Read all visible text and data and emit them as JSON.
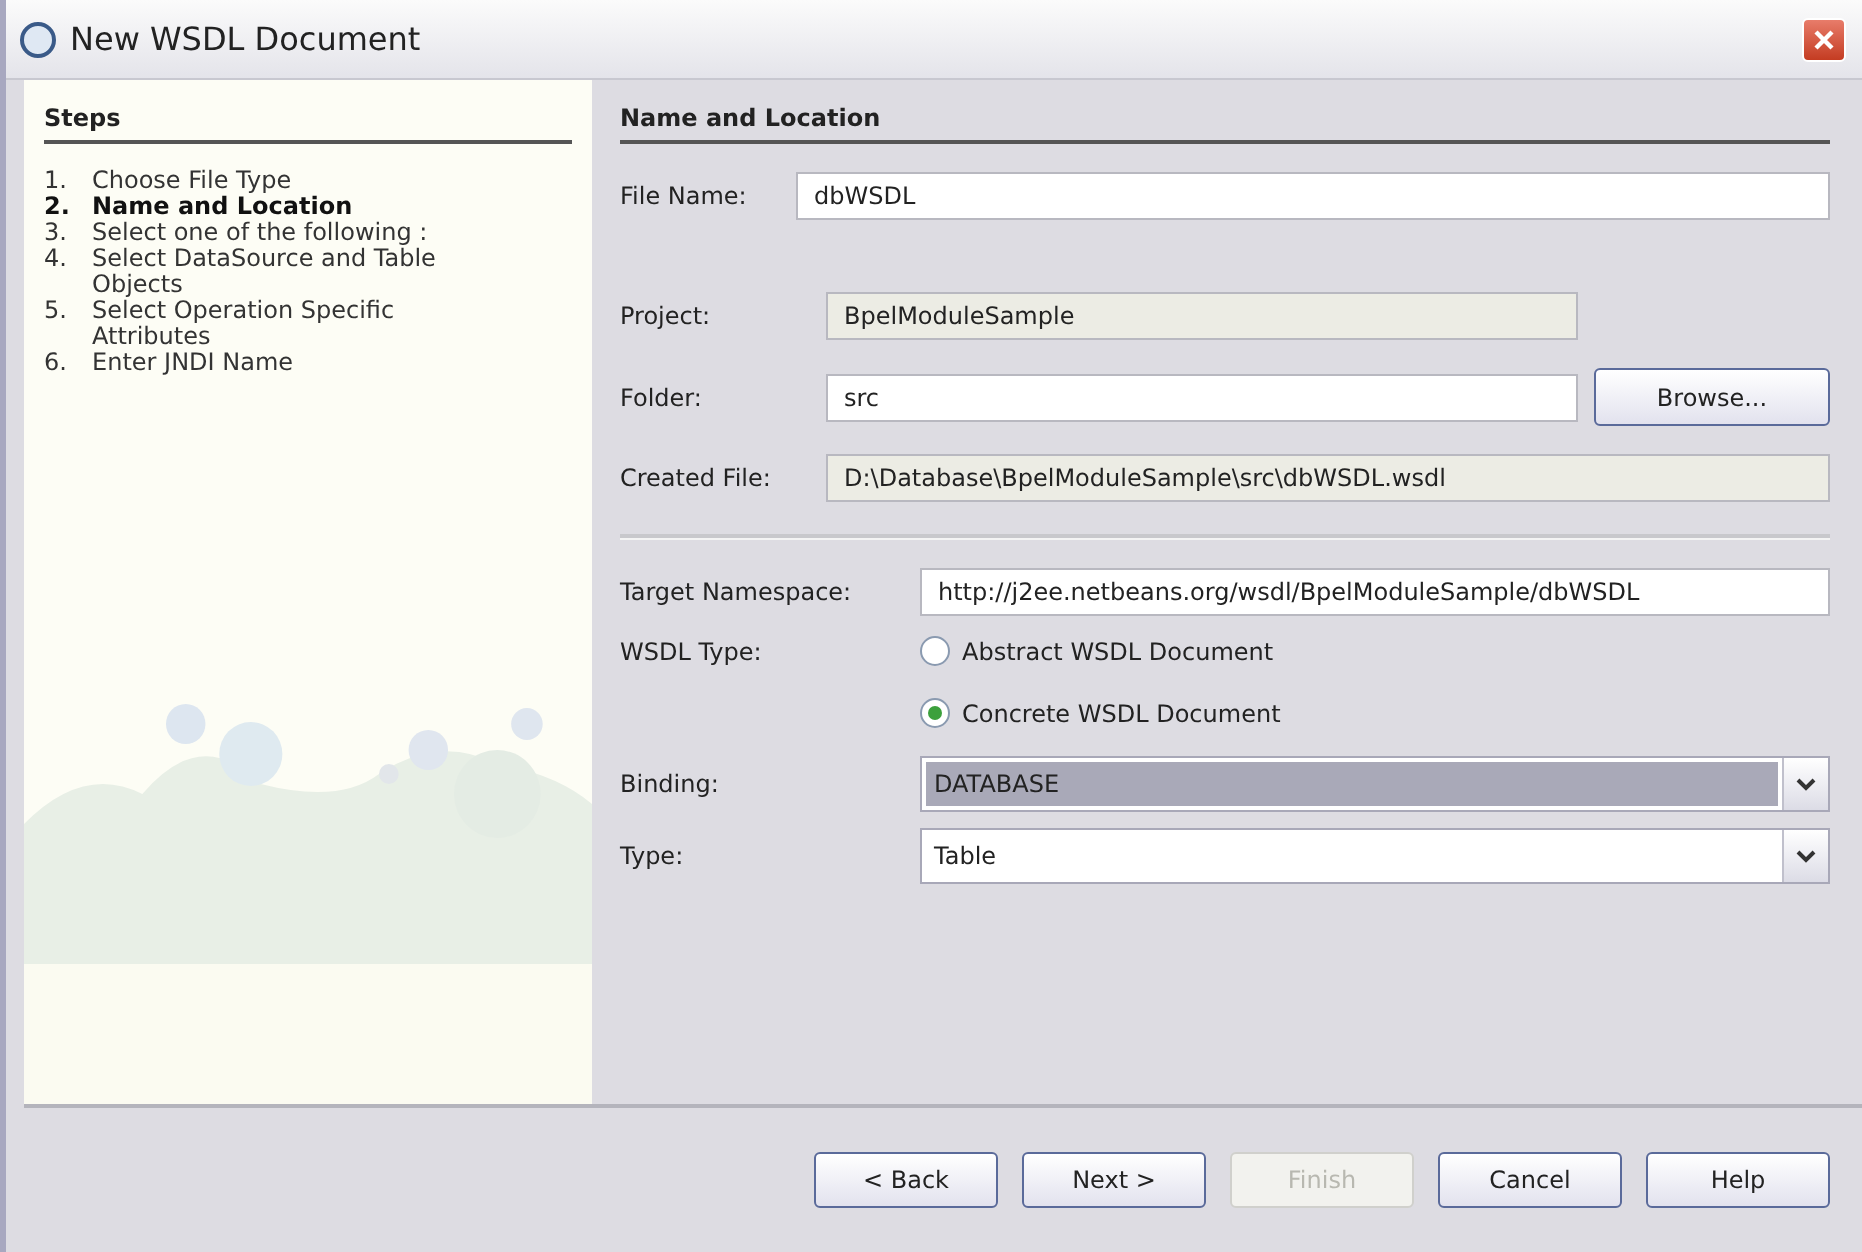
{
  "window": {
    "title": "New WSDL Document"
  },
  "steps": {
    "title": "Steps",
    "items": [
      {
        "number": "1.",
        "label": "Choose File Type",
        "selected": false
      },
      {
        "number": "2.",
        "label": "Name and Location",
        "selected": true
      },
      {
        "number": "3.",
        "label": "Select one of the following :",
        "selected": false
      },
      {
        "number": "4.",
        "label": "Select DataSource and Table Objects",
        "selected": false
      },
      {
        "number": "5.",
        "label": "Select Operation Specific Attributes",
        "selected": false
      },
      {
        "number": "6.",
        "label": "Enter JNDI Name",
        "selected": false
      }
    ]
  },
  "panel": {
    "title": "Name and Location",
    "file_name": {
      "label": "File Name:",
      "value": "dbWSDL"
    },
    "project": {
      "label": "Project:",
      "value": "BpelModuleSample",
      "disabled": true
    },
    "folder": {
      "label": "Folder:",
      "value": "src",
      "button": "Browse..."
    },
    "created_file": {
      "label": "Created File:",
      "value": "D:\\Database\\BpelModuleSample\\src\\dbWSDL.wsdl",
      "disabled": true
    },
    "target_namespace": {
      "label": "Target Namespace:",
      "value": "http://j2ee.netbeans.org/wsdl/BpelModuleSample/dbWSDL"
    },
    "wsdl_type": {
      "label": "WSDL Type:",
      "options": [
        {
          "label": "Abstract WSDL Document",
          "selected": false
        },
        {
          "label": "Concrete WSDL Document",
          "selected": true
        }
      ]
    },
    "binding": {
      "label": "Binding:",
      "value": "DATABASE",
      "focused": true
    },
    "type": {
      "label": "Type:",
      "value": "Table",
      "focused": false
    }
  },
  "buttons": [
    {
      "label": "< Back",
      "disabled": false
    },
    {
      "label": "Next >",
      "disabled": false
    },
    {
      "label": "Finish",
      "disabled": true
    },
    {
      "label": "Cancel",
      "disabled": false
    },
    {
      "label": "Help",
      "disabled": false
    }
  ]
}
